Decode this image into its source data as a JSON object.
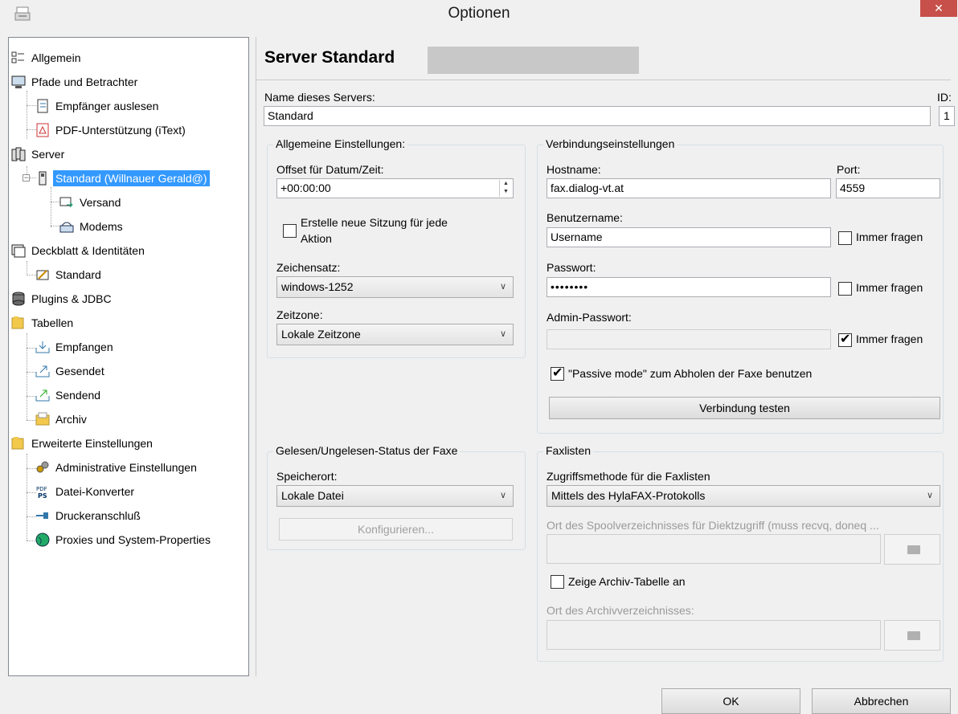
{
  "window": {
    "title": "Optionen",
    "close_glyph": "✕"
  },
  "tree": {
    "items": [
      {
        "label": "Allgemein",
        "icon": "list-icon"
      },
      {
        "label": "Pfade und Betrachter",
        "icon": "monitor-icon"
      },
      {
        "label": "Empfänger auslesen",
        "icon": "address-icon"
      },
      {
        "label": "PDF-Unterstützung (iText)",
        "icon": "pdf-icon"
      },
      {
        "label": "Server",
        "icon": "server-icon"
      },
      {
        "label": "Standard (Willnauer Gerald@)",
        "icon": "phone-icon",
        "selected": true
      },
      {
        "label": "Versand",
        "icon": "send-icon"
      },
      {
        "label": "Modems",
        "icon": "modem-icon"
      },
      {
        "label": "Deckblatt & Identitäten",
        "icon": "cover-icon"
      },
      {
        "label": "Standard",
        "icon": "identity-icon"
      },
      {
        "label": "Plugins & JDBC",
        "icon": "database-icon"
      },
      {
        "label": "Tabellen",
        "icon": "folder-icon"
      },
      {
        "label": "Empfangen",
        "icon": "inbox-icon"
      },
      {
        "label": "Gesendet",
        "icon": "sent-icon"
      },
      {
        "label": "Sendend",
        "icon": "sending-icon"
      },
      {
        "label": "Archiv",
        "icon": "archive-icon"
      },
      {
        "label": "Erweiterte Einstellungen",
        "icon": "folder-icon"
      },
      {
        "label": "Administrative Einstellungen",
        "icon": "gears-icon"
      },
      {
        "label": "Datei-Konverter",
        "icon": "pdf-ps-icon"
      },
      {
        "label": "Druckeranschluß",
        "icon": "plug-icon"
      },
      {
        "label": "Proxies und System-Properties",
        "icon": "globe-icon"
      }
    ]
  },
  "page": {
    "title": "Server Standard",
    "server_name_label": "Name dieses Servers:",
    "server_name_value": "Standard",
    "id_label": "ID:",
    "id_value": "1"
  },
  "general": {
    "group_title": "Allgemeine Einstellungen:",
    "offset_label": "Offset für Datum/Zeit:",
    "offset_value": "+00:00:00",
    "new_session_label_1": "Erstelle neue Sitzung für jede",
    "new_session_label_2": "Aktion",
    "new_session_checked": false,
    "charset_label": "Zeichensatz:",
    "charset_value": "windows-1252",
    "timezone_label": "Zeitzone:",
    "timezone_value": "Lokale Zeitzone"
  },
  "connection": {
    "group_title": "Verbindungseinstellungen",
    "hostname_label": "Hostname:",
    "hostname_value": "fax.dialog-vt.at",
    "port_label": "Port:",
    "port_value": "4559",
    "username_label": "Benutzername:",
    "username_value": "Username",
    "always_ask": "Immer fragen",
    "password_label": "Passwort:",
    "password_value": "••••••••",
    "admin_password_label": "Admin-Passwort:",
    "admin_password_value": "",
    "username_ask_checked": false,
    "password_ask_checked": false,
    "admin_ask_checked": true,
    "passive_label": "\"Passive mode\" zum Abholen der Faxe benutzen",
    "passive_checked": true,
    "test_button": "Verbindung testen"
  },
  "read_status": {
    "group_title": "Gelesen/Ungelesen-Status der Faxe",
    "location_label": "Speicherort:",
    "location_value": "Lokale Datei",
    "configure_button": "Konfigurieren..."
  },
  "faxlists": {
    "group_title": "Faxlisten",
    "access_label": "Zugriffsmethode für die Faxlisten",
    "access_value": "Mittels des HylaFAX-Protokolls",
    "spool_label": "Ort des Spoolverzeichnisses für Diektzugriff (muss recvq, doneq ...",
    "spool_value": "",
    "show_archive_label": "Zeige Archiv-Tabelle an",
    "show_archive_checked": false,
    "archive_dir_label": "Ort des Archivverzeichnisses:",
    "archive_dir_value": ""
  },
  "footer": {
    "ok": "OK",
    "cancel": "Abbrechen"
  },
  "colors": {
    "selection": "#3399ff",
    "close": "#c7504a"
  }
}
